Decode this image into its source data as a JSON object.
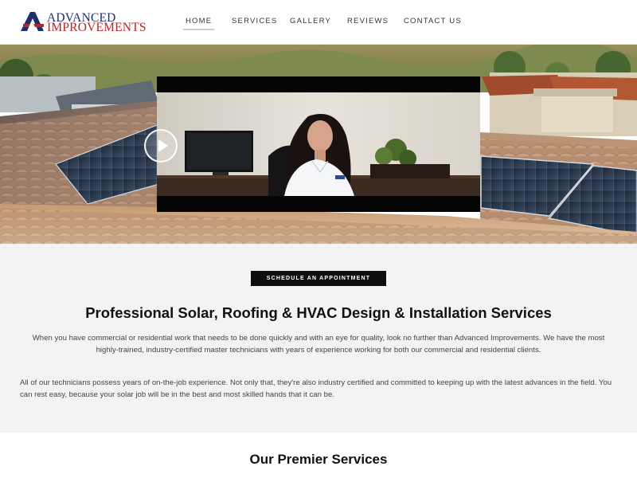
{
  "header": {
    "logo": {
      "line1": "ADVANCED",
      "line2": "IMPROVEMENTS"
    },
    "nav": [
      {
        "label": "HOME",
        "active": true
      },
      {
        "label": "SERVICES",
        "active": false
      },
      {
        "label": "GALLERY",
        "active": false
      },
      {
        "label": "REVIEWS",
        "active": false
      },
      {
        "label": "CONTACT US",
        "active": false
      }
    ]
  },
  "hero": {
    "background": "rooftop with clay tiles and solar panels at sunset",
    "video": {
      "play_icon": "play-icon"
    }
  },
  "intro": {
    "cta_label": "SCHEDULE AN APPOINTMENT",
    "title": "Professional Solar, Roofing & HVAC Design & Installation Services",
    "paragraph1": "When you have commercial or residential work that needs to be done quickly and with an eye for quality, look no further than Advanced Improvements. We have the most highly-trained, industry-certified master technicians with years of experience working for both our commercial and residential clients.",
    "paragraph2": "All of our technicians possess years of on-the-job experience. Not only that, they're also industry certified and committed to keeping up with the latest advances in the field. You can rest easy, because your solar job will be in the best and most skilled hands that it can be."
  },
  "services": {
    "title": "Our Premier Services"
  },
  "colors": {
    "brand_navy": "#1f2f6b",
    "brand_red": "#b3262a",
    "cta_bg": "#0e0e0e",
    "section_bg": "#f3f3f4"
  }
}
